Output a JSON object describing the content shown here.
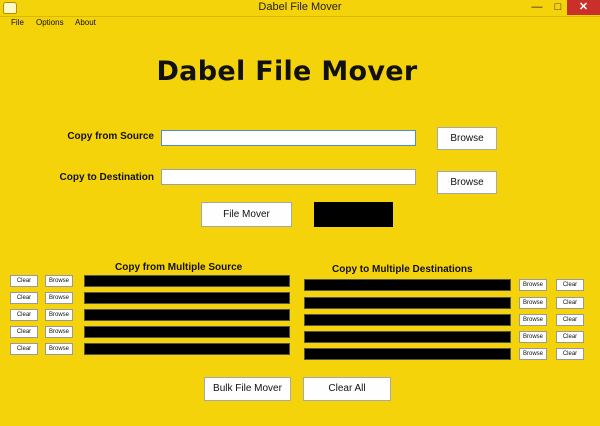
{
  "window": {
    "title": "Dabel File Mover",
    "minimize": "—",
    "maximize": "□",
    "close": "✕"
  },
  "menu": [
    "File",
    "Options",
    "About"
  ],
  "app_title": "Dabel File Mover",
  "single": {
    "source_label": "Copy from Source",
    "source_value": "",
    "destination_label": "Copy to Destination",
    "destination_value": "",
    "browse_label": "Browse",
    "mover_label": "File Mover"
  },
  "multiple": {
    "source_heading": "Copy from Multiple Source",
    "destination_heading": "Copy to Multiple Destinations",
    "clear_label": "Clear",
    "browse_label": "Browse",
    "rows": 5
  },
  "bulk_label": "Bulk File Mover",
  "clear_all_label": "Clear All",
  "colors": {
    "background": "#f5d30a",
    "close_button": "#c9302c"
  }
}
